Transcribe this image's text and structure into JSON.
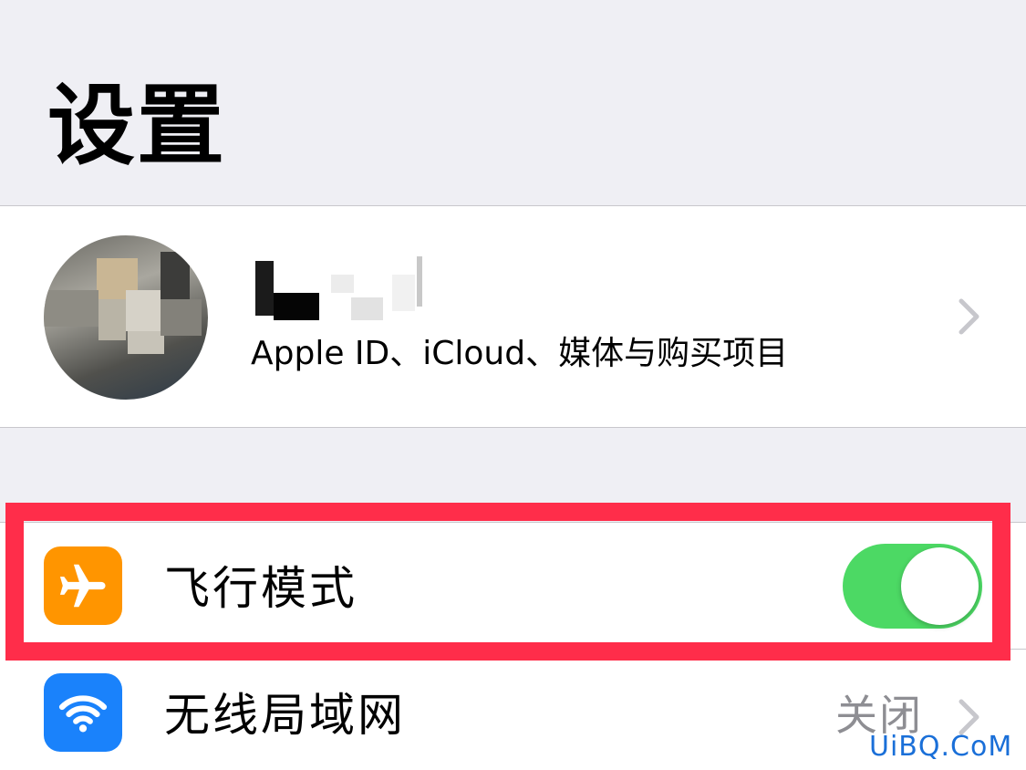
{
  "header": {
    "title": "设置"
  },
  "profile": {
    "subtitle": "Apple ID、iCloud、媒体与购买项目",
    "avatar_icon": "user-avatar-photo",
    "chevron_icon": "chevron-right-icon"
  },
  "rows": [
    {
      "label": "飞行模式",
      "icon": "airplane-icon",
      "icon_color": "#ff9500",
      "toggle_on": true,
      "toggle_color": "#4cd964"
    },
    {
      "label": "无线局域网",
      "icon": "wifi-icon",
      "icon_color": "#1a82fb",
      "detail": "关闭"
    }
  ],
  "highlight_color": "#ff2d4a",
  "watermark": "UiBQ.CoM"
}
